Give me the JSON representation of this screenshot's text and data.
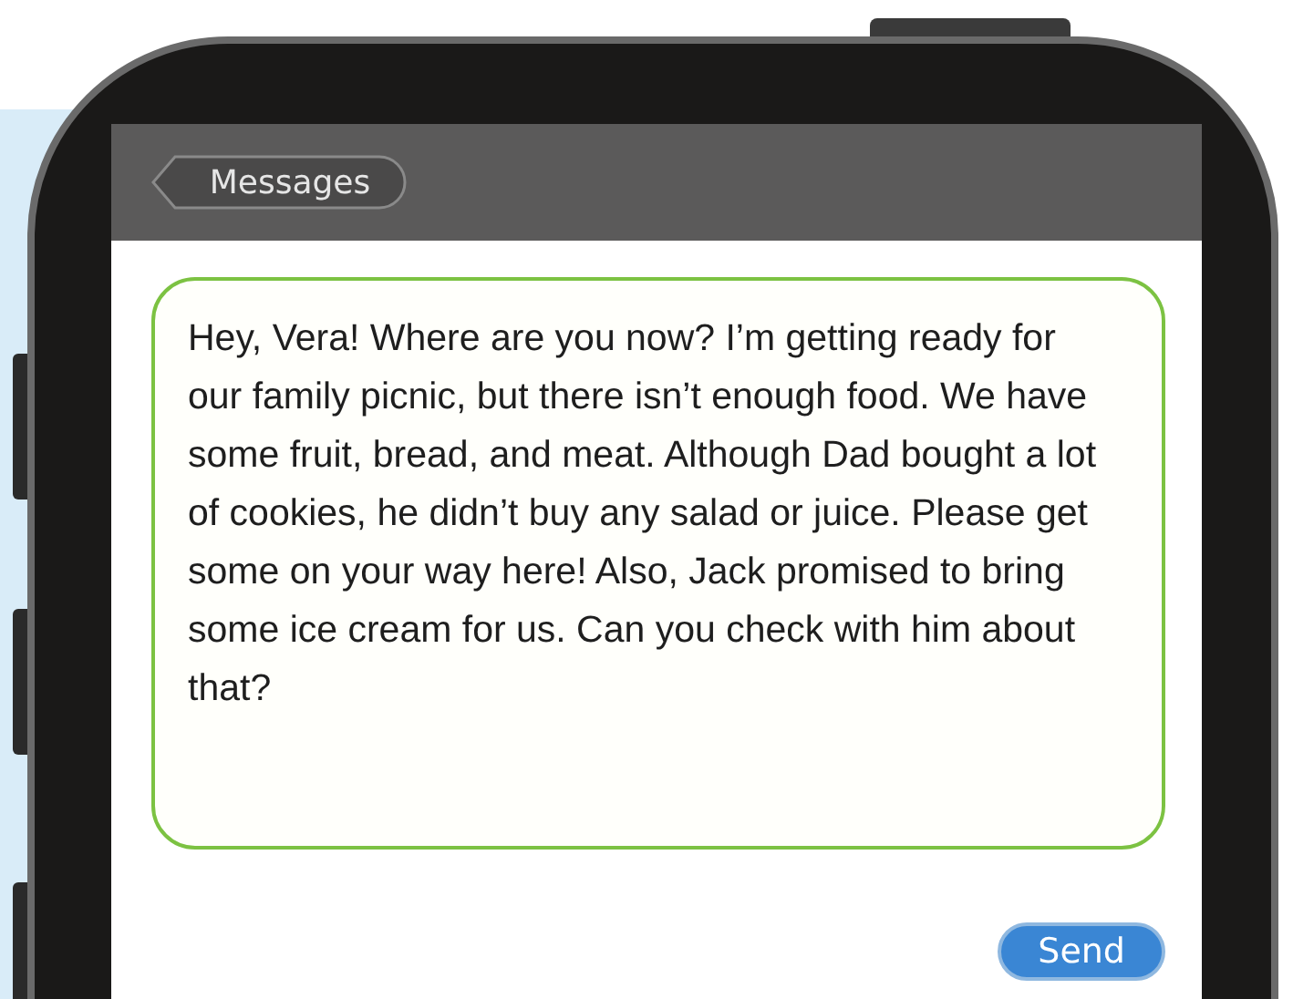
{
  "navigation_bar": {
    "back_button": "Messages"
  },
  "message": {
    "text": "Hey, Vera! Where are you now? I’m getting ready for our family picnic, but there isn’t enough food. We have some fruit, bread, and meat. Although Dad bought a lot of cookies, he didn’t buy any salad or juice. Please get some on your way here! Also, Jack promised to bring some ice cream for us. Can you check with him about that?"
  },
  "send_button": "Send"
}
